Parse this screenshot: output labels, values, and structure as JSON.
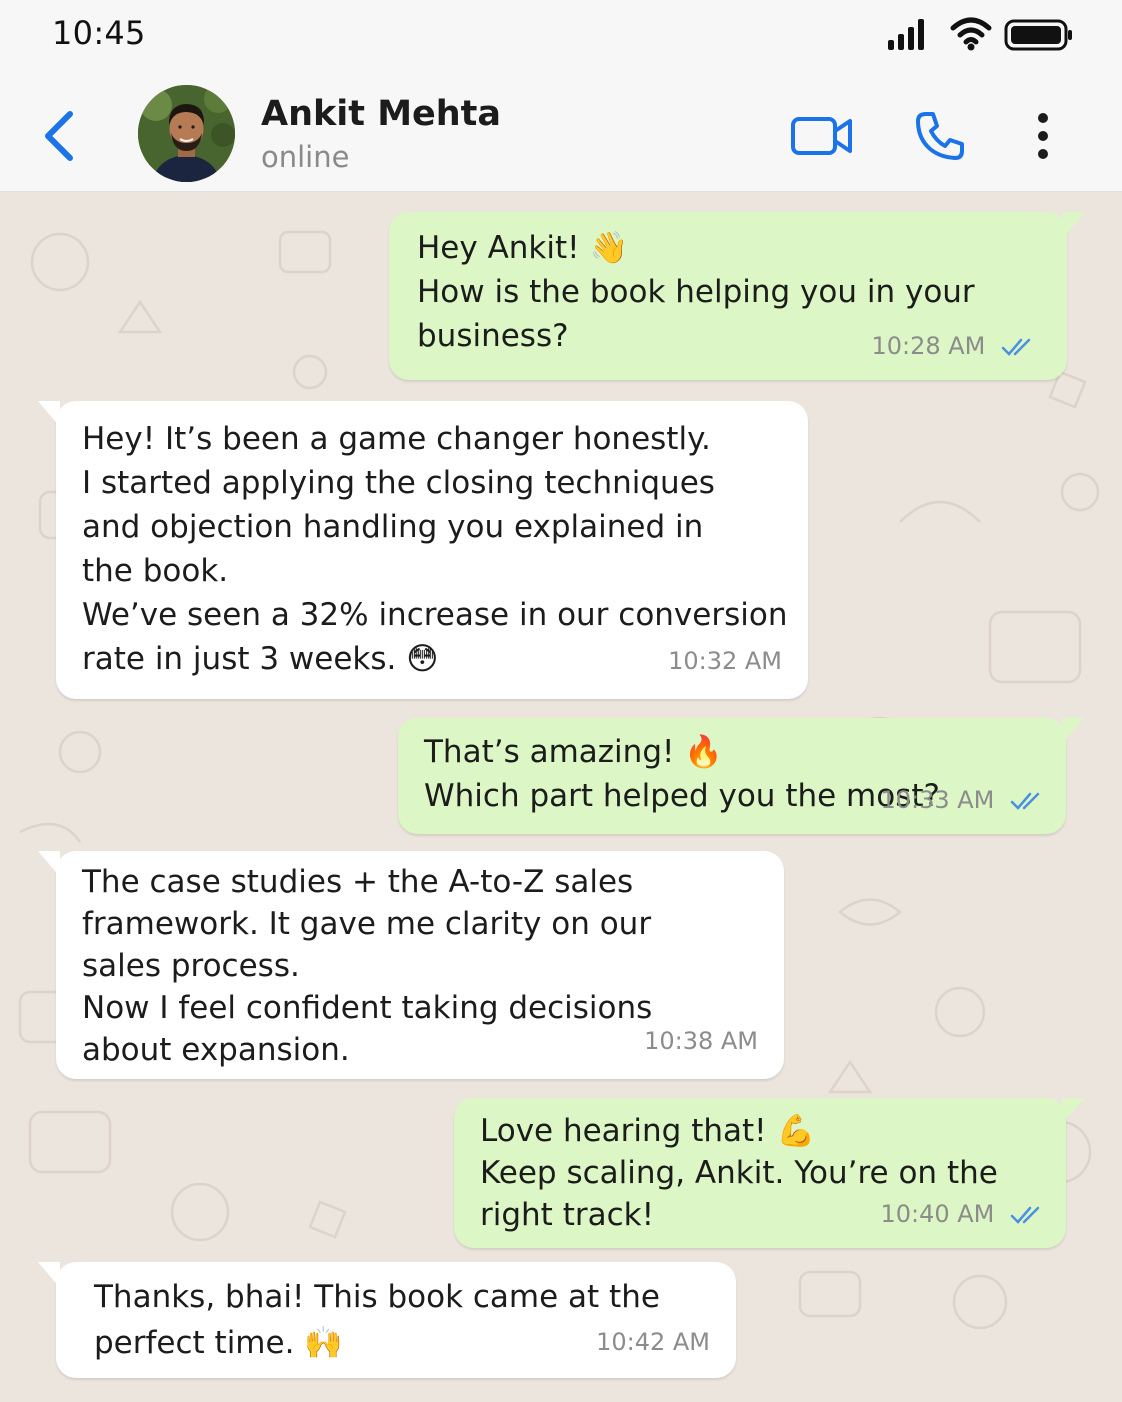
{
  "status_bar": {
    "time": "10:45",
    "icons": [
      "signal-icon",
      "wifi-icon",
      "battery-icon"
    ]
  },
  "header": {
    "contact_name": "Ankit Mehta",
    "contact_status": "online",
    "actions": [
      "video-call-icon",
      "phone-icon",
      "more-options-icon"
    ],
    "accent_color": "#1a73e8"
  },
  "colors": {
    "outgoing_bubble": "#dcf7c5",
    "incoming_bubble": "#ffffff",
    "chat_background": "#ece5dd",
    "read_ticks": "#4a90e2"
  },
  "messages": [
    {
      "direction": "outgoing",
      "lines": [
        "Hey Ankit! 👋",
        "How is the book helping you in your",
        "business?"
      ],
      "time": "10:28 AM",
      "read": true
    },
    {
      "direction": "incoming",
      "lines": [
        "Hey! It’s been a game changer honestly.",
        "I started applying the closing techniques",
        "and objection handling you explained in",
        "the book.",
        "We’ve seen a 32% increase in our conversion",
        "rate in just 3 weeks. 😳"
      ],
      "time": "10:32 AM"
    },
    {
      "direction": "outgoing",
      "lines": [
        "That’s amazing! 🔥",
        "Which part helped you the most?"
      ],
      "time": "10:33 AM",
      "read": true
    },
    {
      "direction": "incoming",
      "lines": [
        "The case studies + the A-to-Z sales",
        "framework. It gave me clarity on our",
        "sales process.",
        "Now I feel confident taking decisions",
        "about expansion."
      ],
      "time": "10:38 AM"
    },
    {
      "direction": "outgoing",
      "lines": [
        "Love hearing that! 💪",
        "Keep scaling, Ankit. You’re on the",
        "right track!"
      ],
      "time": "10:40 AM",
      "read": true
    },
    {
      "direction": "incoming",
      "lines": [
        "Thanks, bhai! This book came at the",
        "perfect time. 🙌"
      ],
      "time": "10:42 AM"
    }
  ]
}
